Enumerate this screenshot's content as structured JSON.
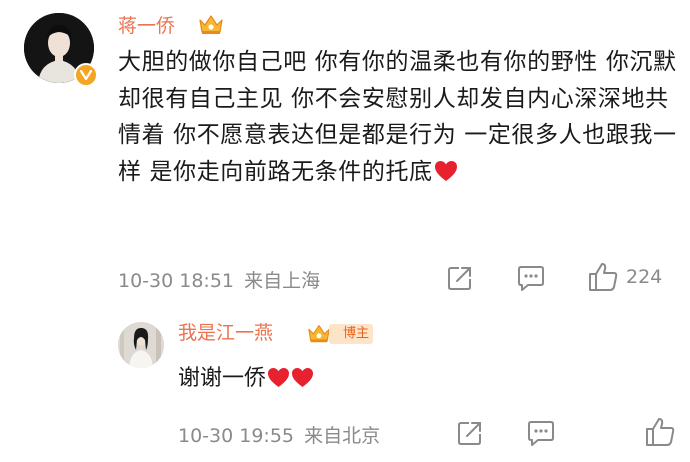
{
  "comment": {
    "author": "蒋一侨",
    "text": "大胆的做你自己吧 你有你的温柔也有你的野性 你沉默却很有自己主见 你不会安慰别人却发自内心深深地共情着 你不愿意表达但是都是行为 一定很多人也跟我一样 是你走向前路无条件的托底",
    "timestamp": "10-30 18:51",
    "location": "来自上海",
    "like_count": "224"
  },
  "reply": {
    "author": "我是江一燕",
    "badge": "博主",
    "text": "谢谢一侨",
    "timestamp": "10-30 19:55",
    "location": "来自北京"
  },
  "icons": {
    "share": "share-icon",
    "comment": "comment-icon",
    "like": "like-icon",
    "verified": "verified-v-icon",
    "crown": "crown-icon",
    "heart": "heart-emoji-icon"
  },
  "colors": {
    "username": "#eb7350",
    "meta": "#8a8a8a",
    "text": "#1a1a1a",
    "verified": "#f5a524",
    "heart": "#e8212e"
  }
}
